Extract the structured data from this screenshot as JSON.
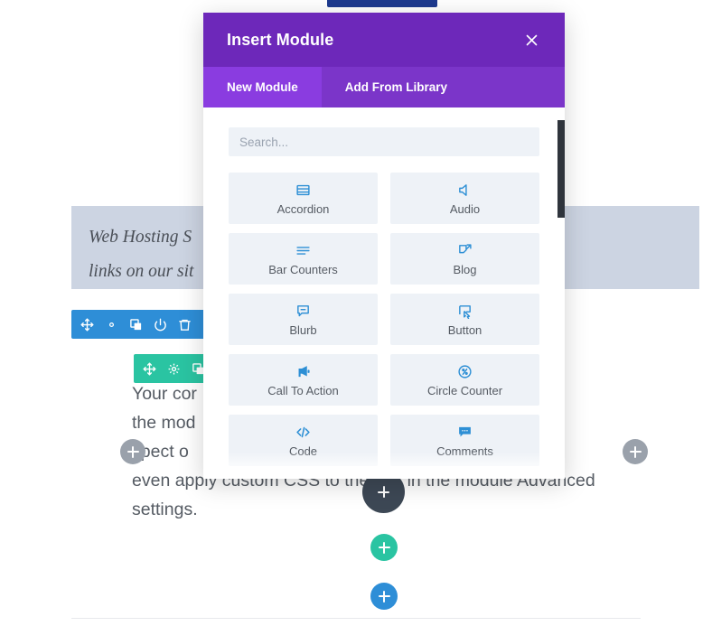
{
  "background": {
    "quote_text": "Web Hosting S                                              ugh referral\nlinks on our sit",
    "body_text": "Your cor                                                       ne or in\nthe mod                                                    ry\nspect o                                                  s and\neven apply custom CSS to the text in the module Advanced\nsettings.",
    "toolbar_blue": {
      "icons": [
        "move-icon",
        "gear-icon",
        "duplicate-icon",
        "power-icon",
        "trash-icon"
      ]
    },
    "toolbar_green": {
      "icons": [
        "move-icon",
        "gear-icon",
        "duplicate-icon"
      ]
    },
    "add_buttons": [
      {
        "name": "add-column-left",
        "color": "#9aa1ab",
        "label": "+"
      },
      {
        "name": "add-column-right",
        "color": "#9aa1ab",
        "label": "+"
      },
      {
        "name": "add-module-dark",
        "color": "#3d4855",
        "label": "+"
      },
      {
        "name": "add-row-green",
        "color": "#2ac4a2",
        "label": "+"
      },
      {
        "name": "add-section-blue",
        "color": "#2e8ed7",
        "label": "+"
      }
    ]
  },
  "modal": {
    "title": "Insert Module",
    "close_icon": "close-icon",
    "header_color": "#6d28ba",
    "tabbar_color": "#7b35c9",
    "active_tab_color": "#8a3ce0",
    "tabs": [
      {
        "label": "New Module",
        "active": true
      },
      {
        "label": "Add From Library",
        "active": false
      }
    ],
    "search": {
      "placeholder": "Search...",
      "value": ""
    },
    "accent_icon_color": "#2d8fd5",
    "tile_color": "#eef2f7",
    "modules": [
      {
        "label": "Accordion",
        "icon": "accordion-icon"
      },
      {
        "label": "Audio",
        "icon": "audio-icon"
      },
      {
        "label": "Bar Counters",
        "icon": "bar-counters-icon"
      },
      {
        "label": "Blog",
        "icon": "blog-icon"
      },
      {
        "label": "Blurb",
        "icon": "blurb-icon"
      },
      {
        "label": "Button",
        "icon": "button-icon"
      },
      {
        "label": "Call To Action",
        "icon": "call-to-action-icon"
      },
      {
        "label": "Circle Counter",
        "icon": "circle-counter-icon"
      },
      {
        "label": "Code",
        "icon": "code-icon"
      },
      {
        "label": "Comments",
        "icon": "comments-icon"
      }
    ]
  }
}
